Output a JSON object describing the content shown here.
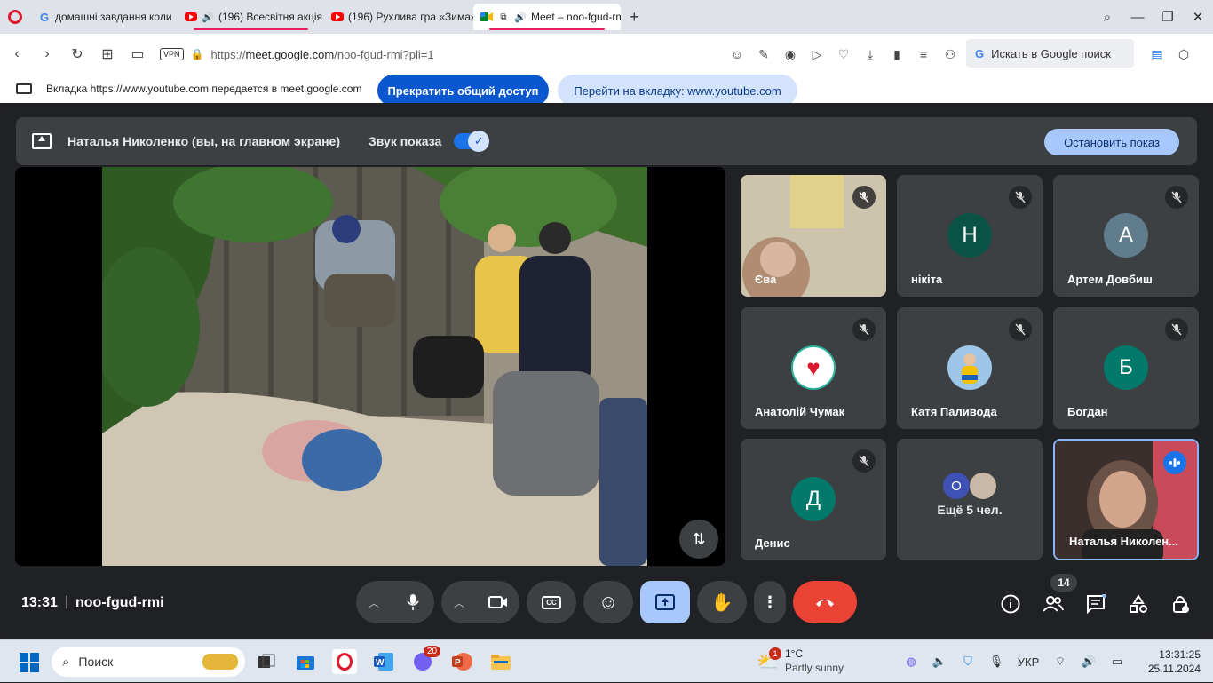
{
  "browser": {
    "tabs": [
      {
        "title": "домашні завдання коли",
        "icon": "google-icon"
      },
      {
        "title": "(196) Всесвітня акція",
        "icon": "youtube-icon",
        "audio": true
      },
      {
        "title": "(196) Рухлива гра «Зима»",
        "icon": "youtube-icon"
      },
      {
        "title": "Meet – noo-fgud-rmi",
        "icon": "meet-icon",
        "active": true
      }
    ],
    "vpn_label": "VPN",
    "url_prefix": "https://",
    "url_host": "meet.google.com",
    "url_path": "/noo-fgud-rmi?pli=1",
    "search_placeholder": "Искать в Google поиск"
  },
  "share_bar": {
    "message": "Вкладка https://www.youtube.com передается в meet.google.com",
    "stop_button": "Прекратить общий доступ",
    "goto_button": "Перейти на вкладку: www.youtube.com"
  },
  "meet": {
    "presenter_text": "Наталья Николенко (вы, на главном экране)",
    "sound_label": "Звук показа",
    "stop_show_button": "Остановить показ",
    "participants": [
      {
        "name": "Єва",
        "type": "video",
        "muted": true
      },
      {
        "name": "нікіта",
        "initial": "Н",
        "color": "#0b5345",
        "muted": true
      },
      {
        "name": "Артем Довбиш",
        "initial": "А",
        "color": "#5f7d8c",
        "muted": true
      },
      {
        "name": "Анатолій Чумак",
        "type": "image",
        "muted": true
      },
      {
        "name": "Катя Паливода",
        "type": "image",
        "muted": true
      },
      {
        "name": "Богдан",
        "initial": "Б",
        "color": "#00796b",
        "muted": true
      },
      {
        "name": "Денис",
        "initial": "Д",
        "color": "#00796b",
        "muted": true
      },
      {
        "name": "Ещё 5 чел.",
        "initial": "О",
        "color": "#3f51b5"
      },
      {
        "name": "Наталья Николен...",
        "type": "video",
        "speaking": true
      }
    ],
    "clock": "13:31",
    "meeting_code": "noo-fgud-rmi",
    "people_count": "14"
  },
  "taskbar": {
    "search_label": "Поиск",
    "weather_temp": "1°C",
    "weather_desc": "Partly sunny",
    "weather_badge": "1",
    "viber_badge": "20",
    "language": "УКР",
    "time": "13:31:25",
    "date": "25.11.2024"
  }
}
